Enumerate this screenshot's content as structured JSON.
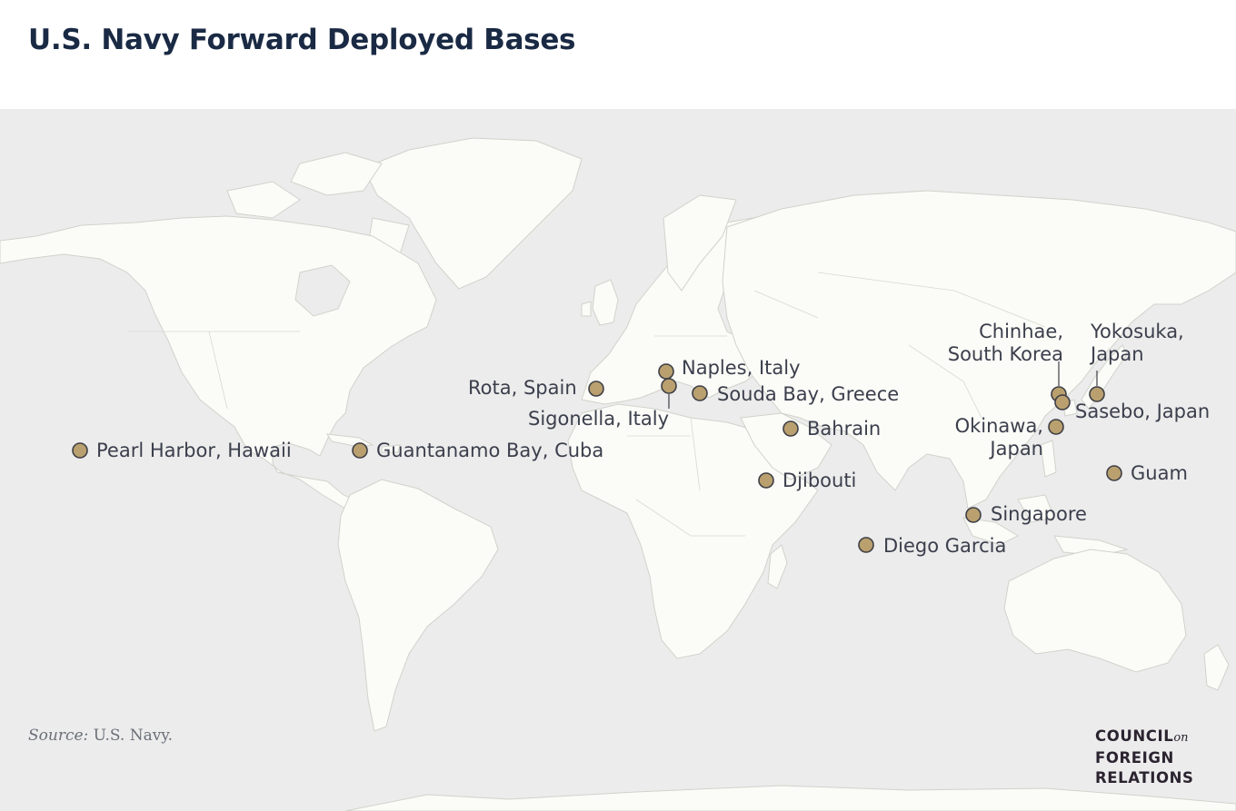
{
  "title": "U.S. Navy Forward Deployed Bases",
  "colors": {
    "ocean": "#ececec",
    "land": "#fbfbf7",
    "marker_fill": "#b9a06e",
    "marker_stroke": "#3e3f46",
    "title": "#1a2a44",
    "label": "#3b3f4c"
  },
  "bases": [
    {
      "name": "Pearl Harbor, Hawaii"
    },
    {
      "name": "Guantanamo Bay, Cuba"
    },
    {
      "name": "Rota, Spain"
    },
    {
      "name": "Naples, Italy"
    },
    {
      "name": "Sigonella, Italy"
    },
    {
      "name": "Souda Bay, Greece"
    },
    {
      "name": "Bahrain"
    },
    {
      "name": "Djibouti"
    },
    {
      "name": "Diego Garcia"
    },
    {
      "name": "Singapore"
    },
    {
      "name": "Chinhae,",
      "line2": "South Korea"
    },
    {
      "name": "Yokosuka,",
      "line2": "Japan"
    },
    {
      "name": "Sasebo, Japan"
    },
    {
      "name": "Okinawa,",
      "line2": "Japan"
    },
    {
      "name": "Guam"
    }
  ],
  "source": {
    "label": "Source:",
    "text": "U.S. Navy."
  },
  "logo": {
    "line1": "COUNCIL",
    "on": "on",
    "line2": "FOREIGN",
    "line3": "RELATIONS"
  }
}
